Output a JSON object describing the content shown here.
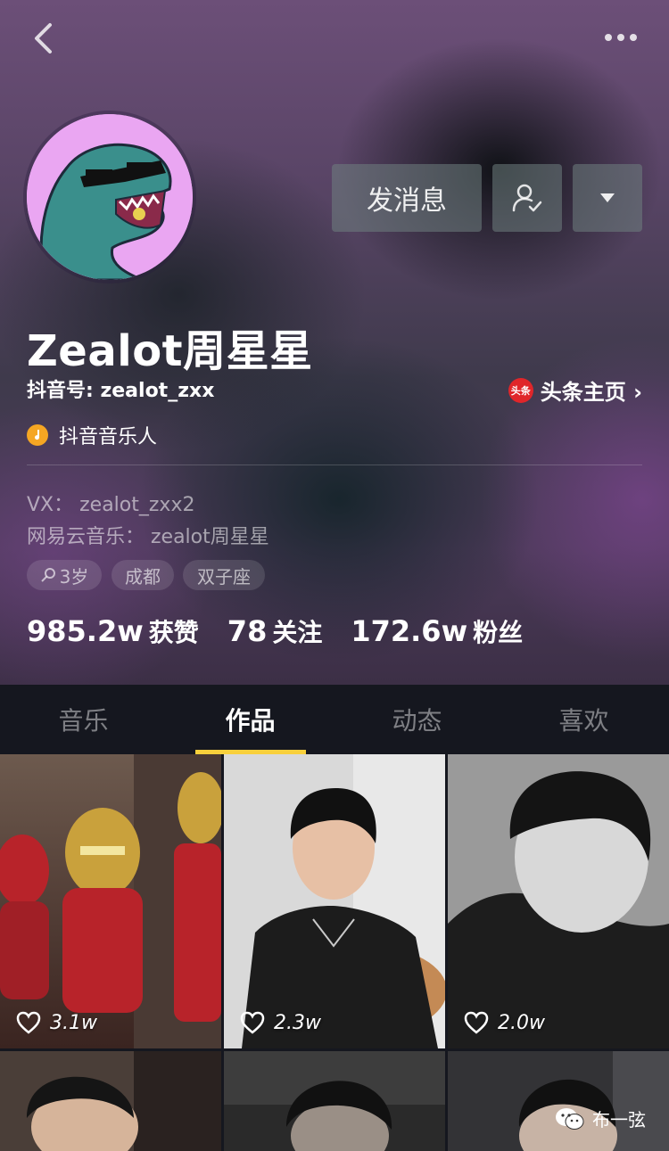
{
  "profile": {
    "name": "Zealot周星星",
    "douyin_id": "抖音号: zealot_zxx",
    "badge_label": "抖音音乐人",
    "bio_vx": "VX：  zealot_zxx2",
    "bio_netease": "网易云音乐：  zealot周星星",
    "tags": {
      "age": "3岁",
      "city": "成都",
      "sign": "双子座"
    }
  },
  "actions": {
    "message_label": "发消息",
    "toutiao_badge": "头条",
    "toutiao_label": "头条主页 ›"
  },
  "stats": [
    {
      "num": "985.2w",
      "label": "获赞"
    },
    {
      "num": "78",
      "label": "关注"
    },
    {
      "num": "172.6w",
      "label": "粉丝"
    }
  ],
  "tabs": [
    {
      "label": "音乐"
    },
    {
      "label": "作品"
    },
    {
      "label": "动态"
    },
    {
      "label": "喜欢"
    }
  ],
  "active_tab": "作品",
  "videos": [
    {
      "likes": "3.1w"
    },
    {
      "likes": "2.3w"
    },
    {
      "likes": "2.0w"
    }
  ],
  "watermark": "布一弦",
  "colors": {
    "accent": "#f8d03c",
    "toutiao_red": "#e0262a",
    "music_badge": "#f5a623",
    "tab_bg": "#15171f"
  }
}
